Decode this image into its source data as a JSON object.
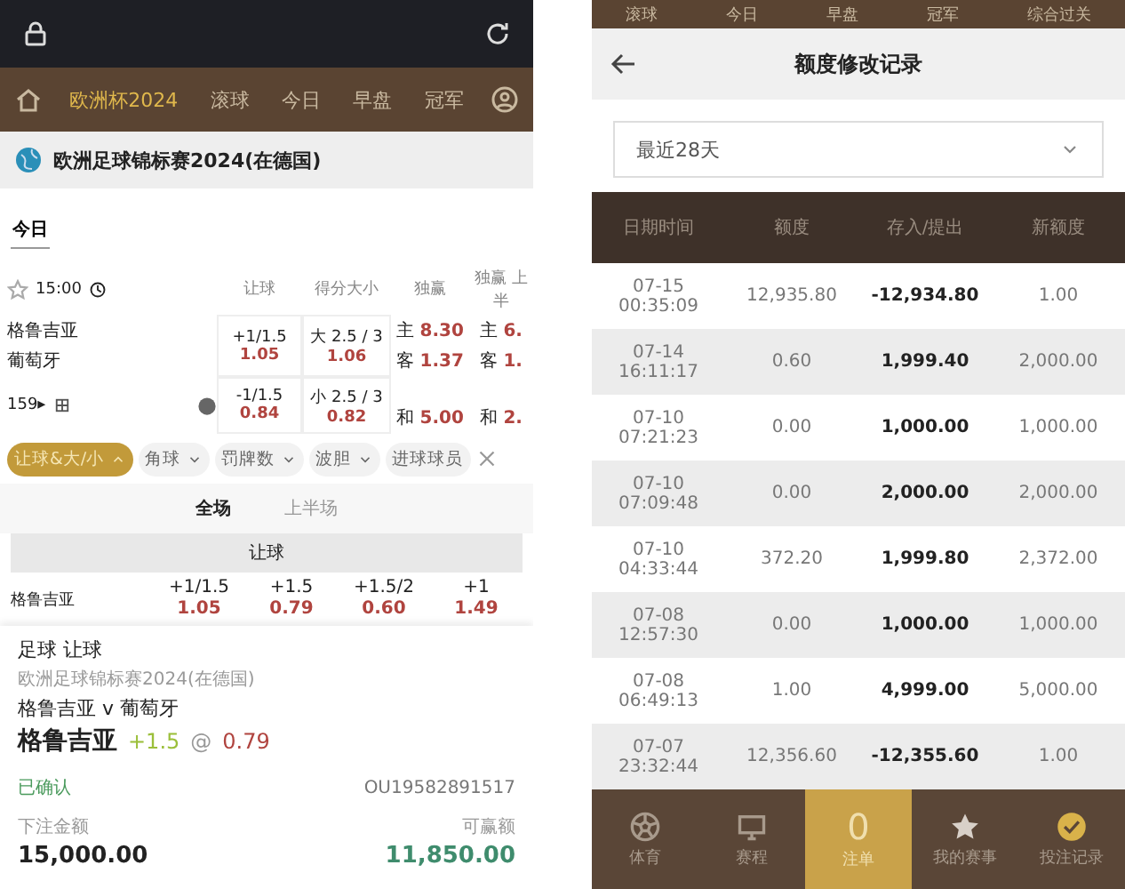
{
  "left": {
    "nav": {
      "items": [
        {
          "label": "欧洲杯2024",
          "selected": true
        },
        {
          "label": "滚球",
          "selected": false
        },
        {
          "label": "今日",
          "selected": false
        },
        {
          "label": "早盘",
          "selected": false
        },
        {
          "label": "冠军",
          "selected": false
        }
      ]
    },
    "league": {
      "title": "欧洲足球锦标赛2024(在德国)"
    },
    "day_tab": {
      "label": "今日",
      "selected": true
    },
    "match": {
      "time": "15:00",
      "columns": [
        "让球",
        "得分大小",
        "独赢",
        "独赢 上半"
      ],
      "teams": [
        "格鲁吉亚",
        "葡萄牙"
      ],
      "more": "159▸",
      "handicap": [
        {
          "line": "+1/1.5",
          "odds": "1.05"
        },
        {
          "line": "-1/1.5",
          "odds": "0.84"
        }
      ],
      "totals": [
        {
          "line": "大 2.5 / 3",
          "odds": "1.06"
        },
        {
          "line": "小 2.5 / 3",
          "odds": "0.82"
        }
      ],
      "moneyline": [
        {
          "label": "主",
          "odds": "8.30"
        },
        {
          "label": "客",
          "odds": "1.37"
        },
        {
          "label": "和",
          "odds": "5.00"
        }
      ],
      "half_moneyline": [
        {
          "label": "主",
          "odds": "6."
        },
        {
          "label": "客",
          "odds": "1."
        },
        {
          "label": "和",
          "odds": "2."
        }
      ]
    },
    "filters": [
      {
        "label": "让球&大/小",
        "selected": true
      },
      {
        "label": "角球",
        "selected": false
      },
      {
        "label": "罚牌数",
        "selected": false
      },
      {
        "label": "波胆",
        "selected": false
      },
      {
        "label": "进球球员",
        "selected": false
      }
    ],
    "periods": [
      {
        "label": "全场",
        "selected": true
      },
      {
        "label": "上半场",
        "selected": false
      }
    ],
    "market": {
      "title": "让球",
      "team": "格鲁吉亚",
      "lines": [
        {
          "line": "+1/1.5",
          "odds": "1.05"
        },
        {
          "line": "+1.5",
          "odds": "0.79"
        },
        {
          "line": "+1.5/2",
          "odds": "0.60"
        },
        {
          "line": "+1",
          "odds": "1.49"
        }
      ]
    },
    "bet_slip": {
      "type": "足球 让球",
      "league": "欧洲足球锦标赛2024(在德国)",
      "fixture": "格鲁吉亚 v 葡萄牙",
      "pick": "格鲁吉亚",
      "line": "+1.5",
      "at": "@",
      "odds": "0.79",
      "status": "已确认",
      "ticket": "OU19582891517",
      "stake_label": "下注金额",
      "stake": "15,000.00",
      "win_label": "可赢额",
      "win": "11,850.00"
    }
  },
  "right": {
    "nav": [
      "滚球",
      "今日",
      "早盘",
      "冠军",
      "综合过关"
    ],
    "title": "额度修改记录",
    "range": {
      "value": "最近28天"
    },
    "table": {
      "columns": [
        "日期时间",
        "额度",
        "存入/提出",
        "新额度"
      ],
      "rows": [
        {
          "date": "07-15",
          "time": "00:35:09",
          "limit": "12,935.80",
          "change": "-12,934.80",
          "new": "1.00"
        },
        {
          "date": "07-14",
          "time": "16:11:17",
          "limit": "0.60",
          "change": "1,999.40",
          "new": "2,000.00"
        },
        {
          "date": "07-10",
          "time": "07:21:23",
          "limit": "0.00",
          "change": "1,000.00",
          "new": "1,000.00"
        },
        {
          "date": "07-10",
          "time": "07:09:48",
          "limit": "0.00",
          "change": "2,000.00",
          "new": "2,000.00"
        },
        {
          "date": "07-10",
          "time": "04:33:44",
          "limit": "372.20",
          "change": "1,999.80",
          "new": "2,372.00"
        },
        {
          "date": "07-08",
          "time": "12:57:30",
          "limit": "0.00",
          "change": "1,000.00",
          "new": "1,000.00"
        },
        {
          "date": "07-08",
          "time": "06:49:13",
          "limit": "1.00",
          "change": "4,999.00",
          "new": "5,000.00"
        },
        {
          "date": "07-07",
          "time": "23:32:44",
          "limit": "12,356.60",
          "change": "-12,355.60",
          "new": "1.00"
        }
      ]
    },
    "tabbar": [
      {
        "kind": "ball",
        "label": "体育",
        "selected": false
      },
      {
        "kind": "monitor",
        "label": "赛程",
        "selected": false
      },
      {
        "kind": "count",
        "count": "0",
        "label": "注单",
        "selected": true
      },
      {
        "kind": "star",
        "label": "我的赛事",
        "selected": false
      },
      {
        "kind": "check",
        "label": "投注记录",
        "selected": false
      }
    ]
  }
}
